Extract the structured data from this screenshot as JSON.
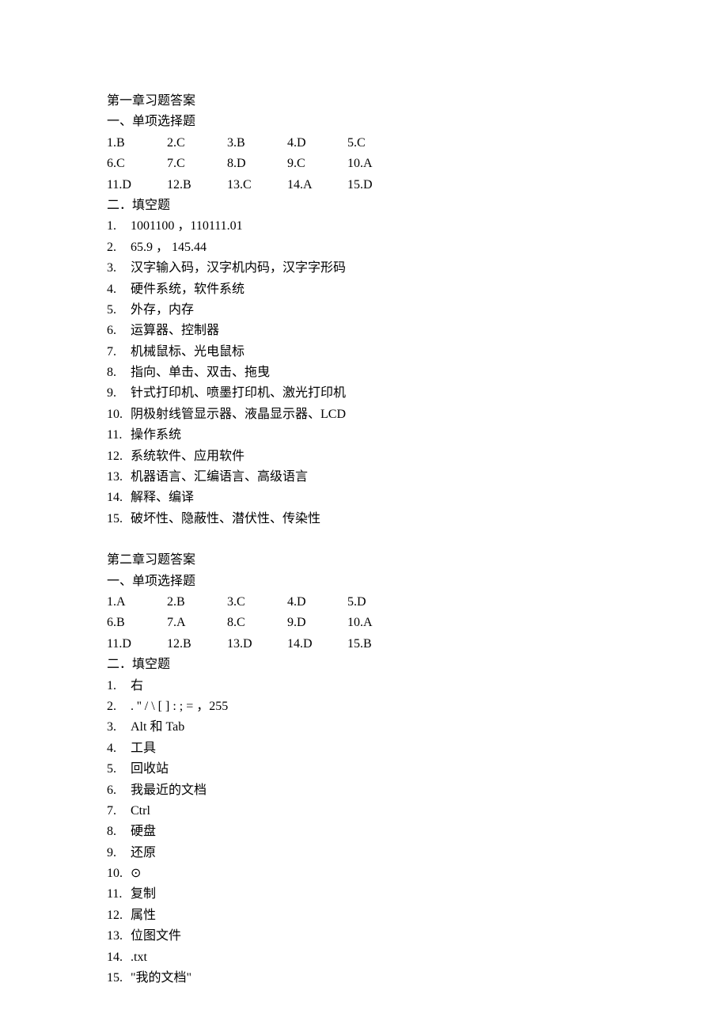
{
  "chapter1": {
    "title": "第一章习题答案",
    "mc_heading": "一、单项选择题",
    "mc_rows": [
      [
        {
          "q": "1.B"
        },
        {
          "q": "2.C"
        },
        {
          "q": "3.B"
        },
        {
          "q": "4.D"
        },
        {
          "q": "5.C"
        }
      ],
      [
        {
          "q": "6.C"
        },
        {
          "q": "7.C"
        },
        {
          "q": "8.D"
        },
        {
          "q": "9.C"
        },
        {
          "q": "10.A"
        }
      ],
      [
        {
          "q": "11.D"
        },
        {
          "q": "12.B"
        },
        {
          "q": "13.C"
        },
        {
          "q": "14.A"
        },
        {
          "q": "15.D"
        }
      ]
    ],
    "fill_heading": "二．填空题",
    "fill_items": [
      {
        "n": "1.",
        "t": "1001100 ，110111.01"
      },
      {
        "n": "2.",
        "t": "65.9 ， 145.44"
      },
      {
        "n": "3.",
        "t": "汉字输入码，汉字机内码，汉字字形码"
      },
      {
        "n": "4.",
        "t": "硬件系统，软件系统"
      },
      {
        "n": "5.",
        "t": "外存，内存"
      },
      {
        "n": "6.",
        "t": "运算器、控制器"
      },
      {
        "n": "7.",
        "t": "机械鼠标、光电鼠标"
      },
      {
        "n": "8.",
        "t": "指向、单击、双击、拖曳"
      },
      {
        "n": "9.",
        "t": "针式打印机、喷墨打印机、激光打印机"
      },
      {
        "n": "10.",
        "t": "阴极射线管显示器、液晶显示器、LCD"
      },
      {
        "n": "11.",
        "t": "操作系统"
      },
      {
        "n": "12.",
        "t": "系统软件、应用软件"
      },
      {
        "n": "13.",
        "t": "机器语言、汇编语言、高级语言"
      },
      {
        "n": "14.",
        "t": "解释、编译"
      },
      {
        "n": "15.",
        "t": "破坏性、隐蔽性、潜伏性、传染性"
      }
    ]
  },
  "chapter2": {
    "title": "第二章习题答案",
    "mc_heading": "一、单项选择题",
    "mc_rows": [
      [
        {
          "q": "1.A"
        },
        {
          "q": "2.B"
        },
        {
          "q": "3.C"
        },
        {
          "q": "4.D"
        },
        {
          "q": "5.D"
        }
      ],
      [
        {
          "q": "6.B"
        },
        {
          "q": "7.A"
        },
        {
          "q": "8.C"
        },
        {
          "q": "9.D"
        },
        {
          "q": "10.A"
        }
      ],
      [
        {
          "q": "11.D"
        },
        {
          "q": "12.B"
        },
        {
          "q": "13.D"
        },
        {
          "q": "14.D"
        },
        {
          "q": "15.B"
        }
      ]
    ],
    "fill_heading": "二．填空题",
    "fill_items": [
      {
        "n": "1.",
        "t": "右"
      },
      {
        "n": "2.",
        "t": ". '' / \\ [ ] : ; =  ，255"
      },
      {
        "n": "3.",
        "t": "Alt 和 Tab"
      },
      {
        "n": "4.",
        "t": "工具"
      },
      {
        "n": "5.",
        "t": "回收站"
      },
      {
        "n": "6.",
        "t": "我最近的文档"
      },
      {
        "n": "7.",
        "t": "Ctrl"
      },
      {
        "n": "8.",
        "t": "硬盘"
      },
      {
        "n": "9.",
        "t": "还原"
      },
      {
        "n": "10.",
        "t": "⊙"
      },
      {
        "n": "11.",
        "t": "复制"
      },
      {
        "n": "12.",
        "t": "属性"
      },
      {
        "n": "13.",
        "t": "位图文件"
      },
      {
        "n": "14.",
        "t": ".txt"
      },
      {
        "n": "15.",
        "t": "\"我的文档\""
      }
    ]
  }
}
